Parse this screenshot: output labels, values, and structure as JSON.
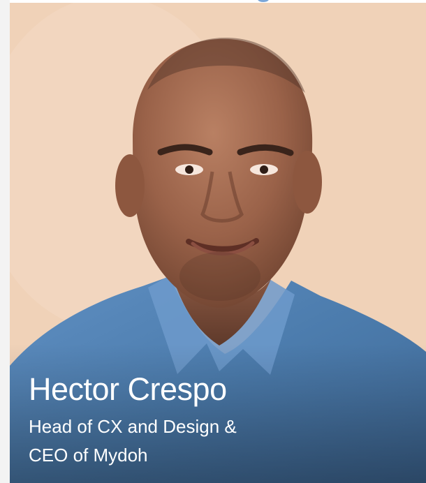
{
  "profile": {
    "name": "Hector Crespo",
    "title_line_1": "Head of CX and Design &",
    "title_line_2": "CEO of Mydoh"
  },
  "colors": {
    "background": "#f1d1b7",
    "shirt": "#4e7fb0",
    "caption_text": "#ffffff"
  }
}
